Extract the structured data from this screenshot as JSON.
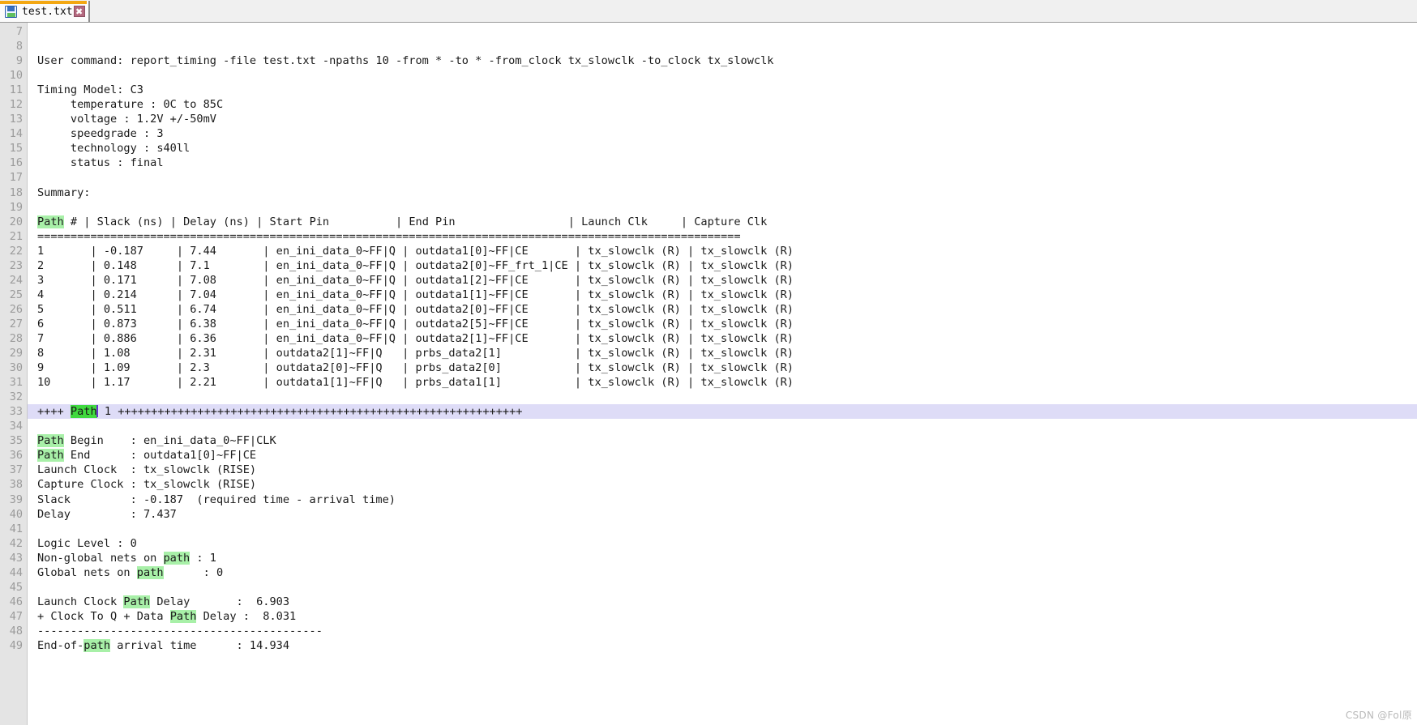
{
  "window": {
    "tab": {
      "label": "test.txt",
      "save_icon": "floppy-save-icon",
      "close_label": "✖",
      "accent_color": "#f3a712"
    }
  },
  "editor": {
    "first_line_number": 7,
    "current_line": 33,
    "search_term": "path",
    "highlight_color": "#a8f0a8",
    "current_match_color": "#3fd93f",
    "current_line_color": "#dedcf7",
    "lines": [
      {
        "n": 7,
        "segments": [
          {
            "t": ""
          }
        ]
      },
      {
        "n": 8,
        "segments": [
          {
            "t": ""
          }
        ]
      },
      {
        "n": 9,
        "segments": [
          {
            "t": "User command: report_timing -file test.txt -npaths 10 -from * -to * -from_clock tx_slowclk -to_clock tx_slowclk"
          }
        ]
      },
      {
        "n": 10,
        "segments": [
          {
            "t": ""
          }
        ]
      },
      {
        "n": 11,
        "segments": [
          {
            "t": "Timing Model: C3"
          }
        ]
      },
      {
        "n": 12,
        "segments": [
          {
            "t": "     temperature : 0C to 85C"
          }
        ]
      },
      {
        "n": 13,
        "segments": [
          {
            "t": "     voltage : 1.2V +/-50mV"
          }
        ]
      },
      {
        "n": 14,
        "segments": [
          {
            "t": "     speedgrade : 3"
          }
        ]
      },
      {
        "n": 15,
        "segments": [
          {
            "t": "     technology : s40ll"
          }
        ]
      },
      {
        "n": 16,
        "segments": [
          {
            "t": "     status : final"
          }
        ]
      },
      {
        "n": 17,
        "segments": [
          {
            "t": ""
          }
        ]
      },
      {
        "n": 18,
        "segments": [
          {
            "t": "Summary:"
          }
        ]
      },
      {
        "n": 19,
        "segments": [
          {
            "t": ""
          }
        ]
      },
      {
        "n": 20,
        "segments": [
          {
            "t": "Path",
            "h": "match"
          },
          {
            "t": " # | Slack (ns) | Delay (ns) | Start Pin          | End Pin                 | Launch Clk     | Capture Clk"
          }
        ]
      },
      {
        "n": 21,
        "segments": [
          {
            "t": "=========================================================================================================="
          }
        ]
      },
      {
        "n": 22,
        "segments": [
          {
            "t": "1       | -0.187     | 7.44       | en_ini_data_0~FF|Q | outdata1[0]~FF|CE       | tx_slowclk (R) | tx_slowclk (R)"
          }
        ]
      },
      {
        "n": 23,
        "segments": [
          {
            "t": "2       | 0.148      | 7.1        | en_ini_data_0~FF|Q | outdata2[0]~FF_frt_1|CE | tx_slowclk (R) | tx_slowclk (R)"
          }
        ]
      },
      {
        "n": 24,
        "segments": [
          {
            "t": "3       | 0.171      | 7.08       | en_ini_data_0~FF|Q | outdata1[2]~FF|CE       | tx_slowclk (R) | tx_slowclk (R)"
          }
        ]
      },
      {
        "n": 25,
        "segments": [
          {
            "t": "4       | 0.214      | 7.04       | en_ini_data_0~FF|Q | outdata1[1]~FF|CE       | tx_slowclk (R) | tx_slowclk (R)"
          }
        ]
      },
      {
        "n": 26,
        "segments": [
          {
            "t": "5       | 0.511      | 6.74       | en_ini_data_0~FF|Q | outdata2[0]~FF|CE       | tx_slowclk (R) | tx_slowclk (R)"
          }
        ]
      },
      {
        "n": 27,
        "segments": [
          {
            "t": "6       | 0.873      | 6.38       | en_ini_data_0~FF|Q | outdata2[5]~FF|CE       | tx_slowclk (R) | tx_slowclk (R)"
          }
        ]
      },
      {
        "n": 28,
        "segments": [
          {
            "t": "7       | 0.886      | 6.36       | en_ini_data_0~FF|Q | outdata2[1]~FF|CE       | tx_slowclk (R) | tx_slowclk (R)"
          }
        ]
      },
      {
        "n": 29,
        "segments": [
          {
            "t": "8       | 1.08       | 2.31       | outdata2[1]~FF|Q   | prbs_data2[1]           | tx_slowclk (R) | tx_slowclk (R)"
          }
        ]
      },
      {
        "n": 30,
        "segments": [
          {
            "t": "9       | 1.09       | 2.3        | outdata2[0]~FF|Q   | prbs_data2[0]           | tx_slowclk (R) | tx_slowclk (R)"
          }
        ]
      },
      {
        "n": 31,
        "segments": [
          {
            "t": "10      | 1.17       | 2.21       | outdata1[1]~FF|Q   | prbs_data1[1]           | tx_slowclk (R) | tx_slowclk (R)"
          }
        ]
      },
      {
        "n": 32,
        "segments": [
          {
            "t": ""
          }
        ]
      },
      {
        "n": 33,
        "current": true,
        "segments": [
          {
            "t": "++++ "
          },
          {
            "t": "Path",
            "h": "current"
          },
          {
            "t": "",
            "caret": true
          },
          {
            "t": " 1 +++++++++++++++++++++++++++++++++++++++++++++++++++++++++++++"
          }
        ]
      },
      {
        "n": 34,
        "segments": [
          {
            "t": ""
          }
        ]
      },
      {
        "n": 35,
        "segments": [
          {
            "t": "Path",
            "h": "match"
          },
          {
            "t": " Begin    : en_ini_data_0~FF|CLK"
          }
        ]
      },
      {
        "n": 36,
        "segments": [
          {
            "t": "Path",
            "h": "match"
          },
          {
            "t": " End      : outdata1[0]~FF|CE"
          }
        ]
      },
      {
        "n": 37,
        "segments": [
          {
            "t": "Launch Clock  : tx_slowclk (RISE)"
          }
        ]
      },
      {
        "n": 38,
        "segments": [
          {
            "t": "Capture Clock : tx_slowclk (RISE)"
          }
        ]
      },
      {
        "n": 39,
        "segments": [
          {
            "t": "Slack         : -0.187  (required time - arrival time)"
          }
        ]
      },
      {
        "n": 40,
        "segments": [
          {
            "t": "Delay         : 7.437"
          }
        ]
      },
      {
        "n": 41,
        "segments": [
          {
            "t": ""
          }
        ]
      },
      {
        "n": 42,
        "segments": [
          {
            "t": "Logic Level : 0"
          }
        ]
      },
      {
        "n": 43,
        "segments": [
          {
            "t": "Non-global nets on "
          },
          {
            "t": "path",
            "h": "match"
          },
          {
            "t": " : 1"
          }
        ]
      },
      {
        "n": 44,
        "segments": [
          {
            "t": "Global nets on "
          },
          {
            "t": "path",
            "h": "match"
          },
          {
            "t": "      : 0"
          }
        ]
      },
      {
        "n": 45,
        "segments": [
          {
            "t": ""
          }
        ]
      },
      {
        "n": 46,
        "segments": [
          {
            "t": "Launch Clock "
          },
          {
            "t": "Path",
            "h": "match"
          },
          {
            "t": " Delay       :  6.903"
          }
        ]
      },
      {
        "n": 47,
        "segments": [
          {
            "t": "+ Clock To Q + Data "
          },
          {
            "t": "Path",
            "h": "match"
          },
          {
            "t": " Delay :  8.031"
          }
        ]
      },
      {
        "n": 48,
        "segments": [
          {
            "t": "-------------------------------------------"
          }
        ]
      },
      {
        "n": 49,
        "segments": [
          {
            "t": "End-of-"
          },
          {
            "t": "path",
            "h": "match"
          },
          {
            "t": " arrival time      : 14.934"
          }
        ]
      }
    ]
  },
  "watermark": {
    "text": "CSDN @Fol原"
  }
}
